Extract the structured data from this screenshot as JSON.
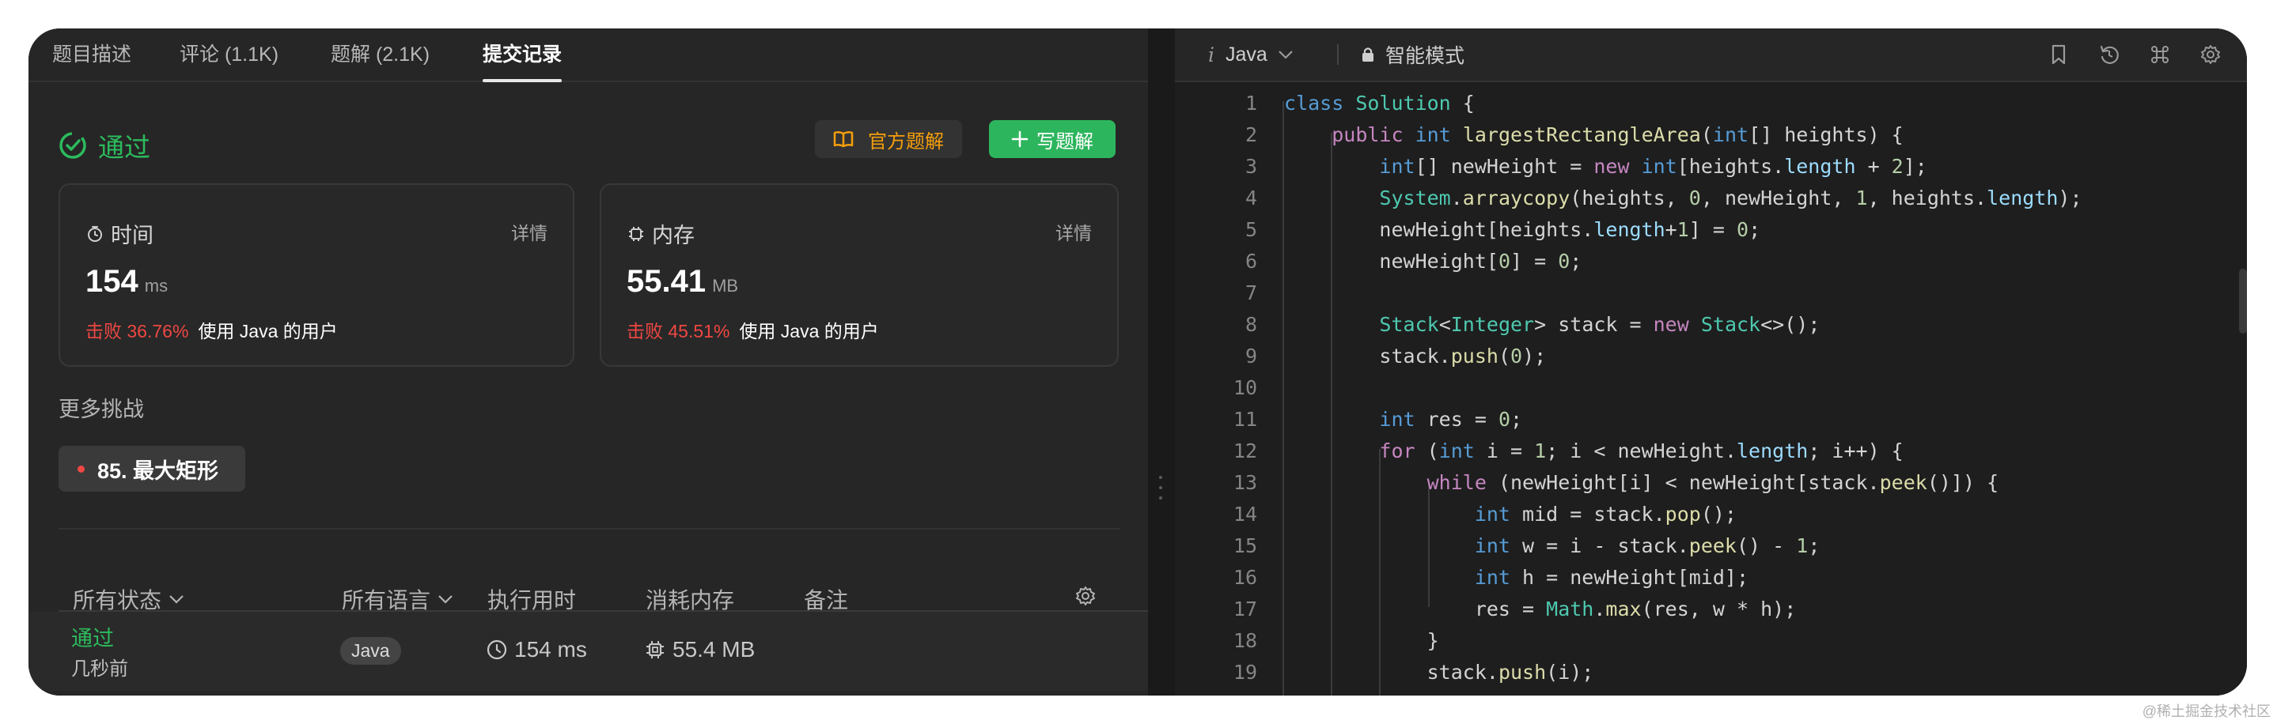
{
  "tabs": [
    {
      "label": "题目描述",
      "active": false
    },
    {
      "label": "评论 (1.1K)",
      "active": false
    },
    {
      "label": "题解 (2.1K)",
      "active": false
    },
    {
      "label": "提交记录",
      "active": true
    }
  ],
  "result": {
    "status": "通过",
    "official_solution_label": "官方题解",
    "write_solution_label": "写题解"
  },
  "runtime_card": {
    "title": "时间",
    "detail": "详情",
    "value": "154",
    "unit": "ms",
    "beat": "击败 36.76%",
    "beat_suffix": "使用 Java 的用户"
  },
  "memory_card": {
    "title": "内存",
    "detail": "详情",
    "value": "55.41",
    "unit": "MB",
    "beat": "击败 45.51%",
    "beat_suffix": "使用 Java 的用户"
  },
  "more_challenges": {
    "title": "更多挑战",
    "items": [
      "85. 最大矩形"
    ]
  },
  "table": {
    "headers": {
      "status": "所有状态",
      "language": "所有语言",
      "runtime": "执行用时",
      "memory": "消耗内存",
      "notes": "备注"
    },
    "rows": [
      {
        "status": "通过",
        "time_ago": "几秒前",
        "language": "Java",
        "runtime": "154 ms",
        "memory": "55.4 MB",
        "notes": ""
      }
    ]
  },
  "editor": {
    "language": "Java",
    "mode": "智能模式",
    "toolbar_icons": [
      "bookmark-icon",
      "reset-icon",
      "command-icon",
      "settings-icon",
      "expand-icon"
    ],
    "code_lines": [
      "class Solution {",
      "    public int largestRectangleArea(int[] heights) {",
      "        int[] newHeight = new int[heights.length + 2];",
      "        System.arraycopy(heights, 0, newHeight, 1, heights.length);",
      "        newHeight[heights.length+1] = 0;",
      "        newHeight[0] = 0;",
      "",
      "        Stack<Integer> stack = new Stack<>();",
      "        stack.push(0);",
      "",
      "        int res = 0;",
      "        for (int i = 1; i < newHeight.length; i++) {",
      "            while (newHeight[i] < newHeight[stack.peek()]) {",
      "                int mid = stack.pop();",
      "                int w = i - stack.peek() - 1;",
      "                int h = newHeight[mid];",
      "                res = Math.max(res, w * h);",
      "            }",
      "            stack.push(i);"
    ]
  },
  "watermark": "@稀土掘金技术社区",
  "colors": {
    "accent_green": "#2cbb5d",
    "beat_red": "#ef4743",
    "solution_orange": "#f59e0b",
    "panel_bg": "#262626",
    "editor_bg": "#1e1e1e"
  }
}
